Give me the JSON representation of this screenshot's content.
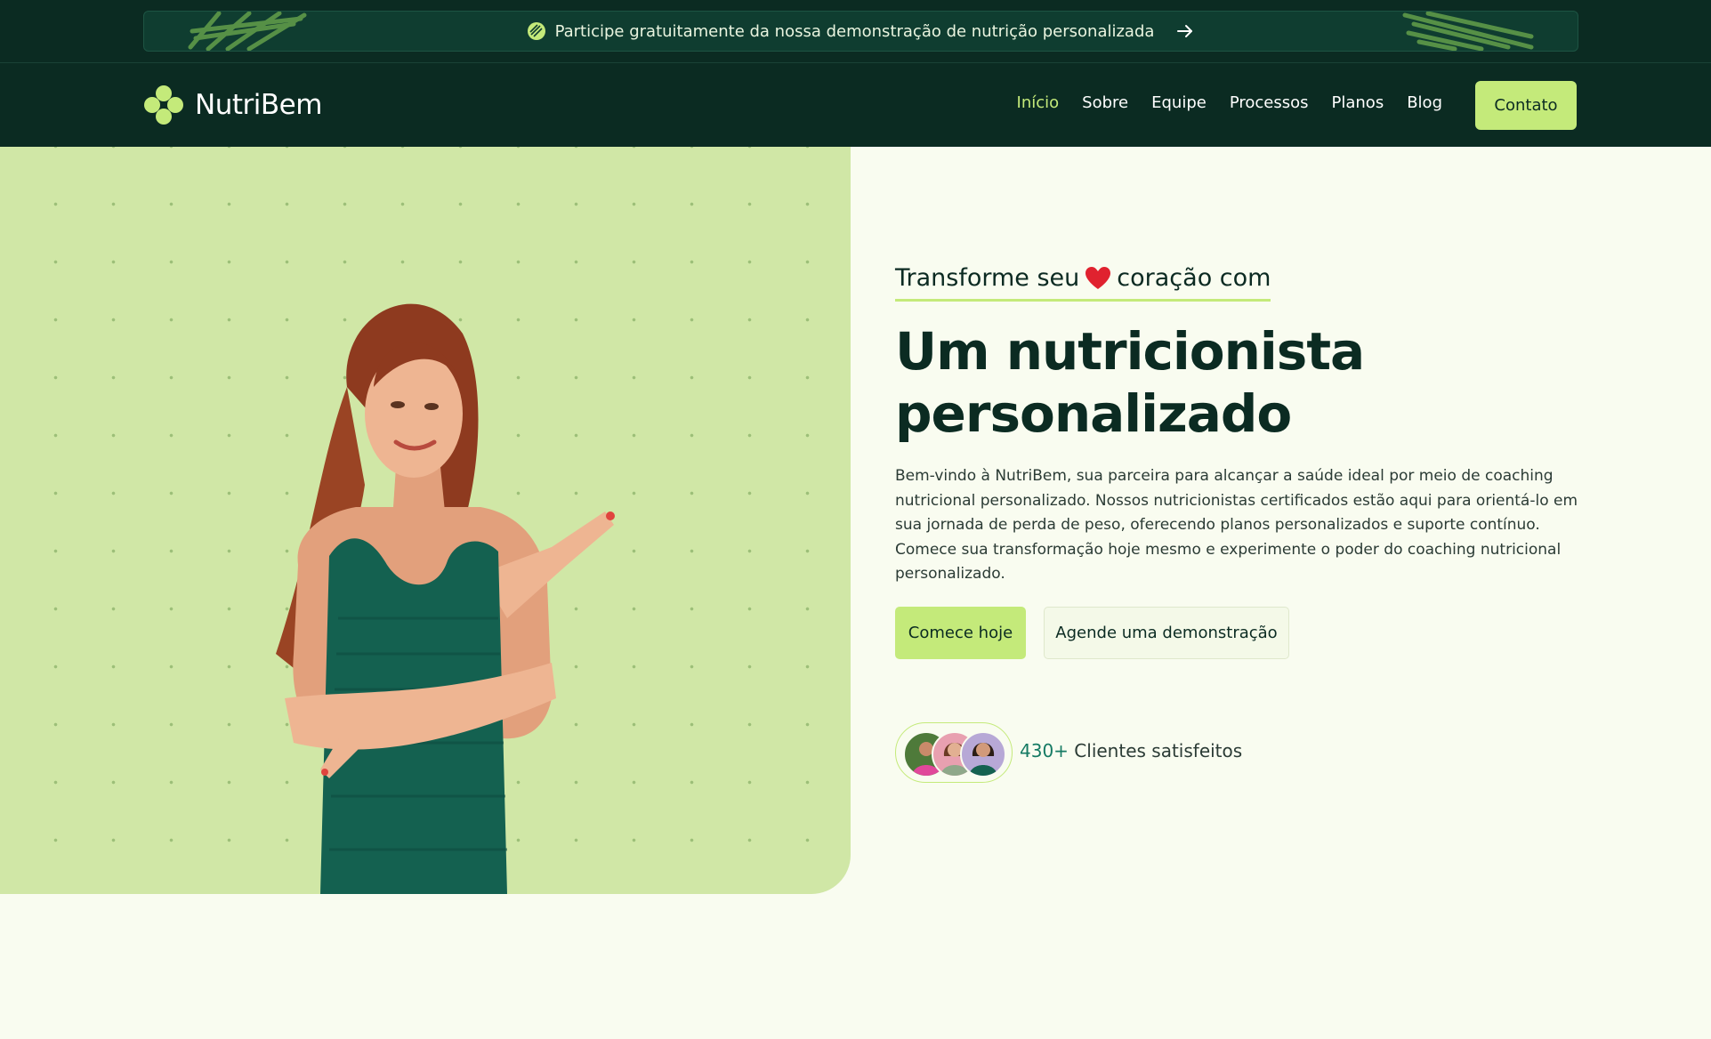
{
  "announcement": {
    "text": "Participe gratuitamente da nossa demonstração de nutrição personalizada",
    "icons": [
      "leaf-icon",
      "arrow-right-icon"
    ]
  },
  "header": {
    "logo_text": "NutriBem",
    "nav": [
      {
        "label": "Início",
        "active": true
      },
      {
        "label": "Sobre",
        "active": false
      },
      {
        "label": "Equipe",
        "active": false
      },
      {
        "label": "Processos",
        "active": false
      },
      {
        "label": "Planos",
        "active": false
      },
      {
        "label": "Blog",
        "active": false
      }
    ],
    "contact_label": "Contato"
  },
  "hero": {
    "tagline_before": "Transforme seu",
    "tagline_after": "coração com",
    "headline_line1": "Um nutricionista",
    "headline_line2": "personalizado",
    "description": "Bem-vindo à NutriBem, sua parceira para alcançar a saúde ideal por meio de coaching nutricional personalizado. Nossos nutricionistas certificados estão aqui para orientá-lo em sua jornada de perda de peso, oferecendo planos personalizados e suporte contínuo. Comece sua transformação hoje mesmo e experimente o poder do coaching nutricional personalizado.",
    "primary_button": "Comece hoje",
    "secondary_button": "Agende uma demonstração",
    "clients_count": "430+",
    "clients_label": "Clientes satisfeitos"
  },
  "colors": {
    "dark_green": "#0b2b22",
    "accent_lime": "#c4ea7a",
    "hero_panel": "#d0e7a6",
    "page_bg": "#f9fcf0",
    "count_teal": "#157a63"
  }
}
